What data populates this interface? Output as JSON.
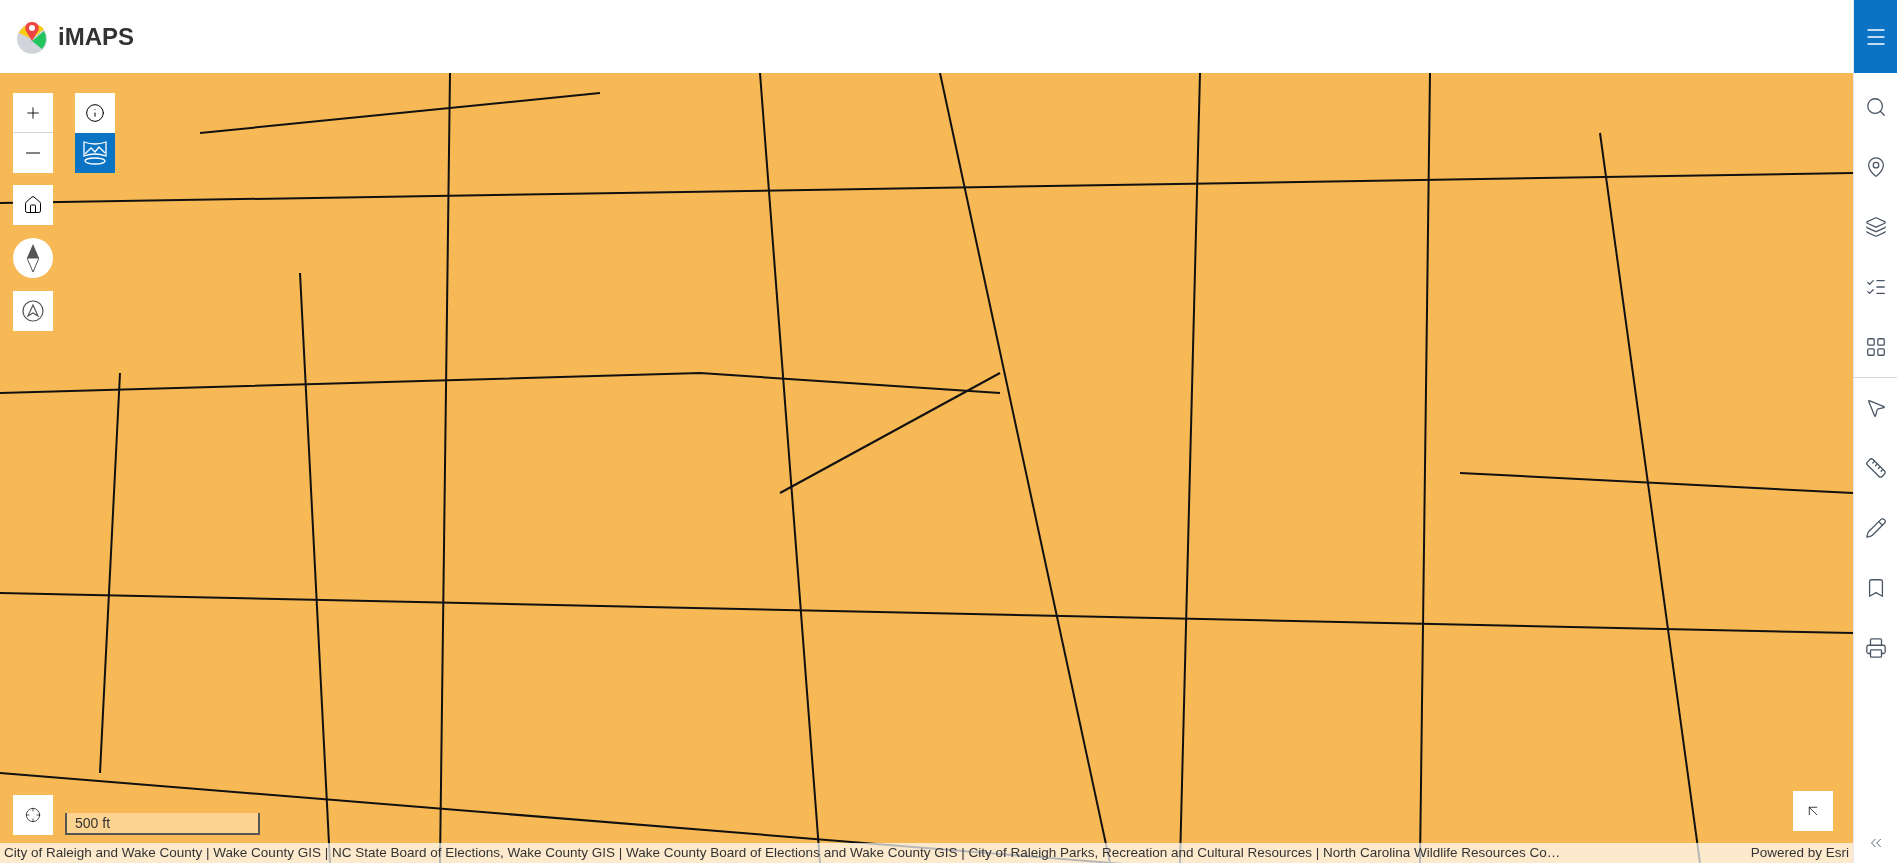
{
  "header": {
    "logo_text": "iMAPS"
  },
  "map": {
    "scale_label": "500 ft",
    "attribution": "City of Raleigh and Wake County | Wake County GIS | NC State Board of Elections, Wake County GIS | Wake County Board of Elections and Wake County GIS | City of Raleigh Parks, Recreation and Cultural Resources | North Carolina Wildlife Resources Co…",
    "powered_by": "Powered by Esri"
  },
  "sidebar": {
    "tool_groups": [
      {
        "tools": [
          {
            "kind": "search"
          },
          {
            "kind": "pin"
          },
          {
            "kind": "layers"
          },
          {
            "kind": "list"
          },
          {
            "kind": "grid"
          }
        ]
      },
      {
        "tools": [
          {
            "kind": "select"
          },
          {
            "kind": "measure"
          },
          {
            "kind": "draw"
          },
          {
            "kind": "bookmark"
          },
          {
            "kind": "print"
          }
        ]
      }
    ]
  }
}
